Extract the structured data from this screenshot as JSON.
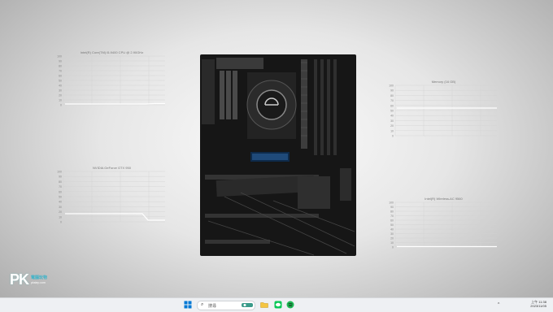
{
  "widgets": {
    "cpu": {
      "title": "Intel(R) Core(TM) i5-9400 CPU @ 2.90GHz",
      "ticks": [
        "100",
        "90",
        "80",
        "70",
        "60",
        "50",
        "40",
        "30",
        "20",
        "10",
        "0"
      ]
    },
    "gpu": {
      "title": "NVIDIA GeForce GTX 950",
      "ticks": [
        "100",
        "90",
        "80",
        "70",
        "60",
        "50",
        "40",
        "30",
        "20",
        "10",
        "0"
      ]
    },
    "memory": {
      "title": "Memory (16 GB)",
      "ticks": [
        "100",
        "90",
        "80",
        "70",
        "60",
        "50",
        "40",
        "30",
        "20",
        "10",
        "0"
      ]
    },
    "network": {
      "title": "Intel(R) Wireless-AC 9560",
      "ticks": [
        "100",
        "90",
        "80",
        "70",
        "60",
        "50",
        "40",
        "30",
        "20",
        "10",
        "0"
      ]
    }
  },
  "logo": {
    "mark": "PK",
    "site_name": "電腦玩物",
    "url": "pkstep.com"
  },
  "taskbar": {
    "search_placeholder": "搜尋",
    "tray_chevron": "^",
    "clock_time": "上午 11:38",
    "clock_date": "2023/11/05"
  },
  "colors": {
    "accent_blue": "#0078d4",
    "green_app": "#06c755",
    "spotify": "#1db954",
    "folder": "#f5c542"
  }
}
